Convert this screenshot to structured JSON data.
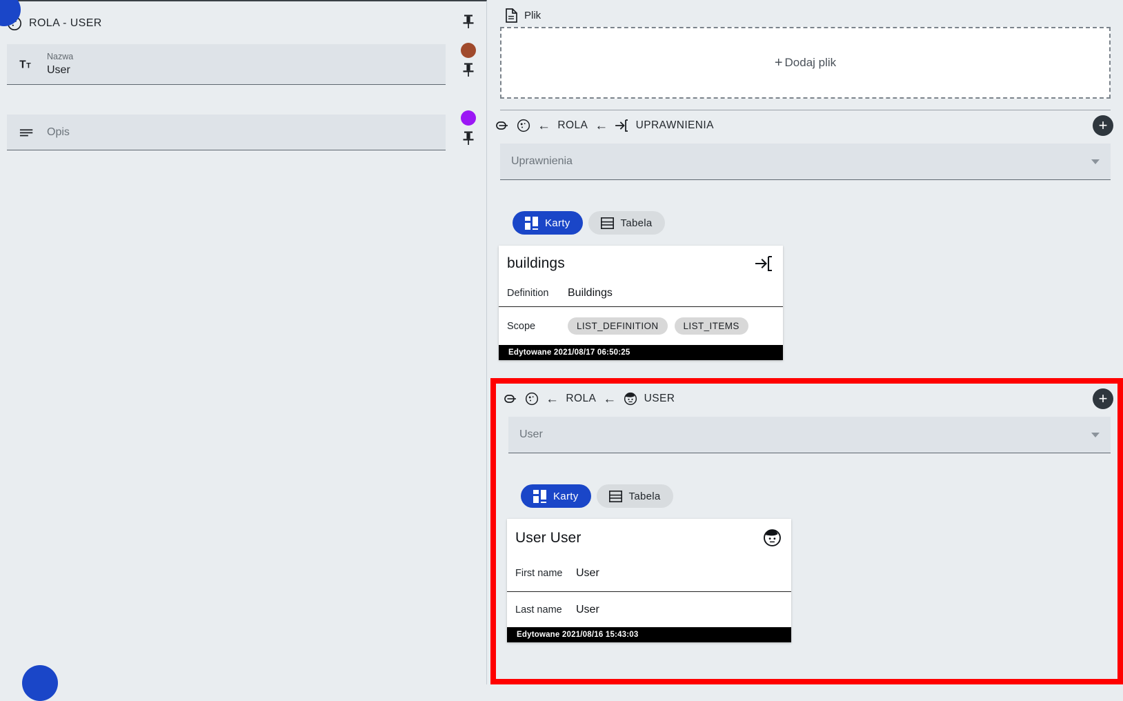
{
  "theme": {
    "background": "#e9edf0",
    "accent_blue": "#1a46c8",
    "field_fill": "#dee3e8",
    "highlight_red": "#ff0000",
    "chip_gray": "#d8d8d8",
    "footer_black": "#000000"
  },
  "left_panel": {
    "header": {
      "icon": "role-mask-icon",
      "title": "ROLA - USER"
    },
    "fields": [
      {
        "icon": "text-format-icon",
        "label": "Nazwa",
        "value": "User",
        "placeholder": "",
        "pin_icon": "pin-icon",
        "dot_color": "#a04a2c"
      },
      {
        "icon": "description-lines-icon",
        "label": "",
        "value": "",
        "placeholder": "Opis",
        "pin_icon": "pin-icon",
        "dot_color": "#9b17f5"
      }
    ],
    "top_pin_icon": "pin-icon",
    "fab_icon": "fab-action-button"
  },
  "right_panel": {
    "file_section": {
      "icon": "file-document-icon",
      "label": "Plik",
      "dropzone_label": "Dodaj plik",
      "dropzone_plus": "+"
    },
    "permissions_section": {
      "breadcrumb": {
        "link_icon": "link-chain-icon",
        "entity_icon": "role-mask-icon",
        "arrow1": "←",
        "parent": "ROLA",
        "arrow2": "←",
        "target_icon": "login-arrow-icon",
        "target": "UPRAWNIENIA"
      },
      "add_button_label": "+",
      "select_value": "Uprawnienia",
      "view_toggle": [
        {
          "label": "Karty",
          "icon": "cards-grid-icon",
          "active": true
        },
        {
          "label": "Tabela",
          "icon": "table-rows-icon",
          "active": false
        }
      ],
      "card": {
        "title": "buildings",
        "action_icon": "login-arrow-icon",
        "rows": [
          {
            "key": "Definition",
            "value": "Buildings",
            "chips": []
          },
          {
            "key": "Scope",
            "value": "",
            "chips": [
              "LIST_DEFINITION",
              "LIST_ITEMS"
            ]
          }
        ],
        "footer": "Edytowane 2021/08/17 06:50:25"
      }
    },
    "user_section": {
      "highlighted": true,
      "breadcrumb": {
        "link_icon": "link-chain-icon",
        "entity_icon": "role-mask-icon",
        "arrow1": "←",
        "parent": "ROLA",
        "arrow2": "←",
        "target_icon": "user-face-icon",
        "target": "USER"
      },
      "add_button_label": "+",
      "select_value": "User",
      "view_toggle": [
        {
          "label": "Karty",
          "icon": "cards-grid-icon",
          "active": true
        },
        {
          "label": "Tabela",
          "icon": "table-rows-icon",
          "active": false
        }
      ],
      "card": {
        "title": "User User",
        "action_icon": "user-face-icon",
        "rows": [
          {
            "key": "First name",
            "value": "User"
          },
          {
            "key": "Last name",
            "value": "User"
          }
        ],
        "footer": "Edytowane 2021/08/16 15:43:03"
      }
    }
  }
}
